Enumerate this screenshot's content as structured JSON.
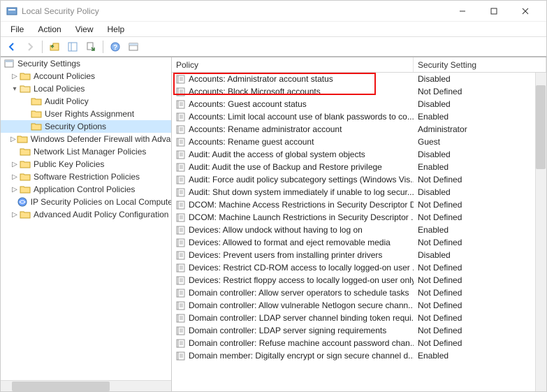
{
  "window": {
    "title": "Local Security Policy"
  },
  "menu": {
    "file": "File",
    "action": "Action",
    "view": "View",
    "help": "Help"
  },
  "tree": {
    "root": "Security Settings",
    "account_policies": "Account Policies",
    "local_policies": "Local Policies",
    "audit_policy": "Audit Policy",
    "user_rights": "User Rights Assignment",
    "security_options": "Security Options",
    "firewall": "Windows Defender Firewall with Advanced Security",
    "network_list": "Network List Manager Policies",
    "public_key": "Public Key Policies",
    "software_restriction": "Software Restriction Policies",
    "app_control": "Application Control Policies",
    "ip_security": "IP Security Policies on Local Computer",
    "advanced_audit": "Advanced Audit Policy Configuration"
  },
  "columns": {
    "policy": "Policy",
    "setting": "Security Setting"
  },
  "policies": [
    {
      "name": "Accounts: Administrator account status",
      "value": "Disabled"
    },
    {
      "name": "Accounts: Block Microsoft accounts",
      "value": "Not Defined"
    },
    {
      "name": "Accounts: Guest account status",
      "value": "Disabled"
    },
    {
      "name": "Accounts: Limit local account use of blank passwords to co...",
      "value": "Enabled"
    },
    {
      "name": "Accounts: Rename administrator account",
      "value": "Administrator"
    },
    {
      "name": "Accounts: Rename guest account",
      "value": "Guest"
    },
    {
      "name": "Audit: Audit the access of global system objects",
      "value": "Disabled"
    },
    {
      "name": "Audit: Audit the use of Backup and Restore privilege",
      "value": "Enabled"
    },
    {
      "name": "Audit: Force audit policy subcategory settings (Windows Vis...",
      "value": "Not Defined"
    },
    {
      "name": "Audit: Shut down system immediately if unable to log secur...",
      "value": "Disabled"
    },
    {
      "name": "DCOM: Machine Access Restrictions in Security Descriptor D...",
      "value": "Not Defined"
    },
    {
      "name": "DCOM: Machine Launch Restrictions in Security Descriptor ...",
      "value": "Not Defined"
    },
    {
      "name": "Devices: Allow undock without having to log on",
      "value": "Enabled"
    },
    {
      "name": "Devices: Allowed to format and eject removable media",
      "value": "Not Defined"
    },
    {
      "name": "Devices: Prevent users from installing printer drivers",
      "value": "Disabled"
    },
    {
      "name": "Devices: Restrict CD-ROM access to locally logged-on user ...",
      "value": "Not Defined"
    },
    {
      "name": "Devices: Restrict floppy access to locally logged-on user only",
      "value": "Not Defined"
    },
    {
      "name": "Domain controller: Allow server operators to schedule tasks",
      "value": "Not Defined"
    },
    {
      "name": "Domain controller: Allow vulnerable Netlogon secure chann...",
      "value": "Not Defined"
    },
    {
      "name": "Domain controller: LDAP server channel binding token requi...",
      "value": "Not Defined"
    },
    {
      "name": "Domain controller: LDAP server signing requirements",
      "value": "Not Defined"
    },
    {
      "name": "Domain controller: Refuse machine account password chan...",
      "value": "Not Defined"
    },
    {
      "name": "Domain member: Digitally encrypt or sign secure channel d...",
      "value": "Enabled"
    }
  ]
}
